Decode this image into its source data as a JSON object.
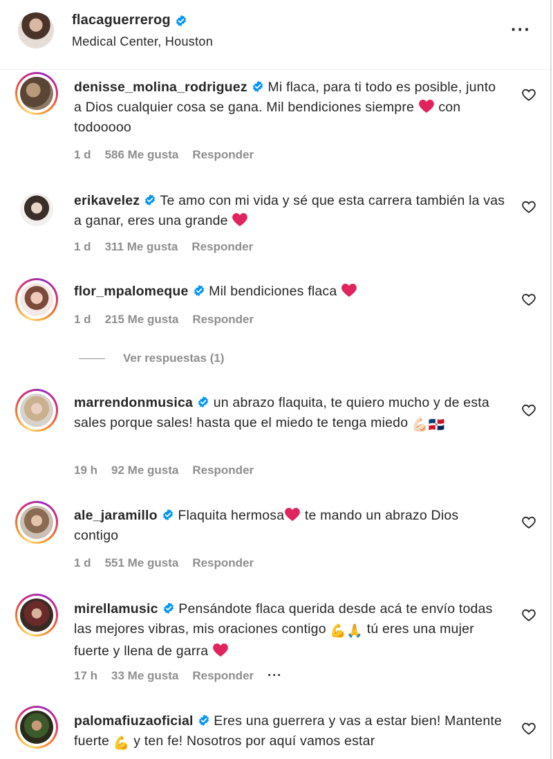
{
  "header": {
    "username": "flacaguerrerog",
    "location": "Medical Center, Houston",
    "more_icon": "more-horizontal-icon"
  },
  "comments": [
    {
      "username": "denisse_molina_rodriguez",
      "text_a": "Mi flaca, para ti todo es posible, junto a Dios cualquier cosa se gana. Mil bendiciones siempre",
      "text_b": "con todooooo",
      "time": "1 d",
      "likes": "586 Me gusta",
      "reply": "Responder"
    },
    {
      "username": "erikavelez",
      "text_a": "Te amo con mi vida y sé que esta carrera también la vas a ganar, eres una grande",
      "time": "1 d",
      "likes": "311 Me gusta",
      "reply": "Responder"
    },
    {
      "username": "flor_mpalomeque",
      "text_a": "Mil bendiciones flaca",
      "time": "1 d",
      "likes": "215 Me gusta",
      "reply": "Responder",
      "view_replies": "Ver respuestas (1)"
    },
    {
      "username": "marrendonmusica",
      "text_a": "un abrazo flaquita, te quiero mucho y de esta sales porque sales! hasta que el miedo te tenga miedo",
      "emoji": "💪🏻🇩🇴",
      "time": "19 h",
      "likes": "92 Me gusta",
      "reply": "Responder"
    },
    {
      "username": "ale_jaramillo",
      "text_a": "Flaquita hermosa",
      "text_b": "te mando un abrazo Dios contigo",
      "time": "1 d",
      "likes": "551 Me gusta",
      "reply": "Responder"
    },
    {
      "username": "mirellamusic",
      "text_a": "Pensándote flaca querida desde acá te envío todas las mejores vibras, mis oraciones contigo",
      "emoji": "💪🙏",
      "text_b": "tú eres una mujer fuerte y llena de garra",
      "time": "17 h",
      "likes": "33 Me gusta",
      "reply": "Responder",
      "more": "···"
    },
    {
      "username": "palomafiuzaoficial",
      "text_a": "Eres una guerrera y vas a estar bien! Mantente fuerte",
      "emoji": "💪",
      "text_b": "y ten fe! Nosotros por aquí vamos estar"
    }
  ],
  "colors": {
    "verified": "#0095f6",
    "meta_text": "#8e8e8e",
    "heart_emoji": "#e0245e"
  },
  "icons": [
    "verified-badge-icon",
    "heart-outline-icon",
    "red-heart-emoji-icon"
  ]
}
